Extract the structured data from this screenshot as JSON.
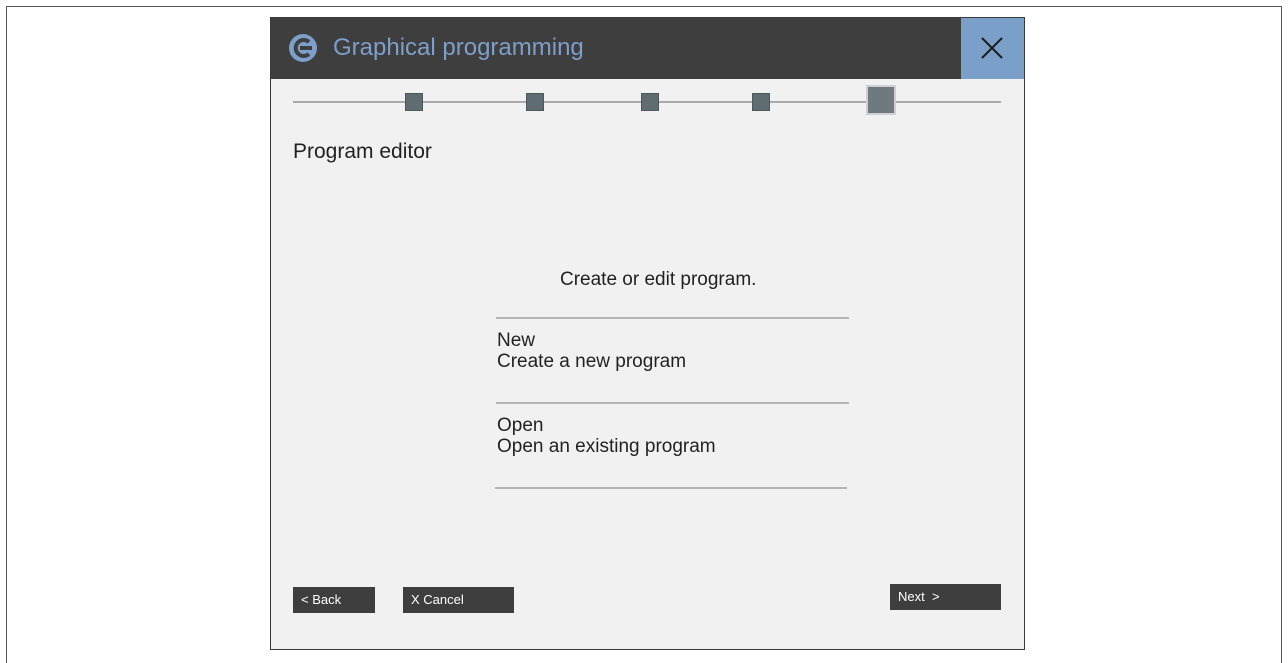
{
  "window": {
    "title": "Graphical programming",
    "logo_icon": "app-logo-icon",
    "close_icon": "close-icon",
    "colors": {
      "titlebar": "#3e3e3e",
      "title_text": "#7d9fc9",
      "close_bg": "#7a9fc9",
      "body_bg": "#f1f1f2"
    }
  },
  "stepper": {
    "total_steps": 5,
    "current_step": 5
  },
  "page": {
    "title": "Program editor",
    "prompt": "Create or edit program."
  },
  "options": [
    {
      "title": "New",
      "description": "Create a new program"
    },
    {
      "title": "Open",
      "description": "Open an existing program"
    }
  ],
  "buttons": {
    "back": "< Back",
    "cancel": "X Cancel",
    "next": "Next  >"
  }
}
